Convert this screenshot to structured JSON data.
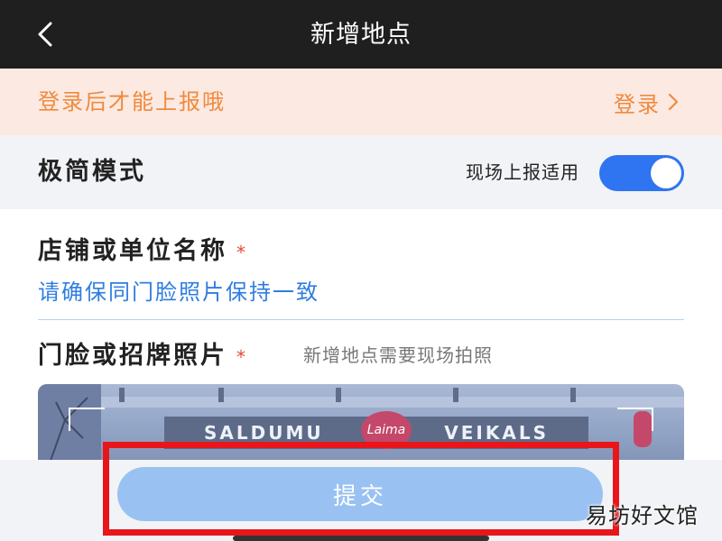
{
  "nav": {
    "title": "新增地点"
  },
  "login_bar": {
    "message": "登录后才能上报哦",
    "link": "登录"
  },
  "mode": {
    "label": "极简模式",
    "hint": "现场上报适用",
    "enabled": true
  },
  "form": {
    "name_label": "店铺或单位名称",
    "name_required_mark": "*",
    "name_placeholder": "请确保同门脸照片保持一致",
    "photo_label": "门脸或招牌照片",
    "photo_required_mark": "*",
    "photo_note": "新增地点需要现场拍照",
    "photo_sign_left": "SALDUMU",
    "photo_sign_right": "VEIKALS",
    "photo_logo": "Laima"
  },
  "submit": {
    "label": "提交"
  },
  "watermark": "易坊好文馆",
  "colors": {
    "accent": "#2f74f0",
    "login_text": "#f08a3c",
    "login_bg": "#fbe9e2",
    "required": "#e24a3b",
    "placeholder": "#2f7de1",
    "submit_bg": "#99c2f2",
    "highlight_border": "#e8161b"
  },
  "icons": {
    "back": "chevron-left-icon",
    "login_arrow": "chevron-right-icon"
  }
}
